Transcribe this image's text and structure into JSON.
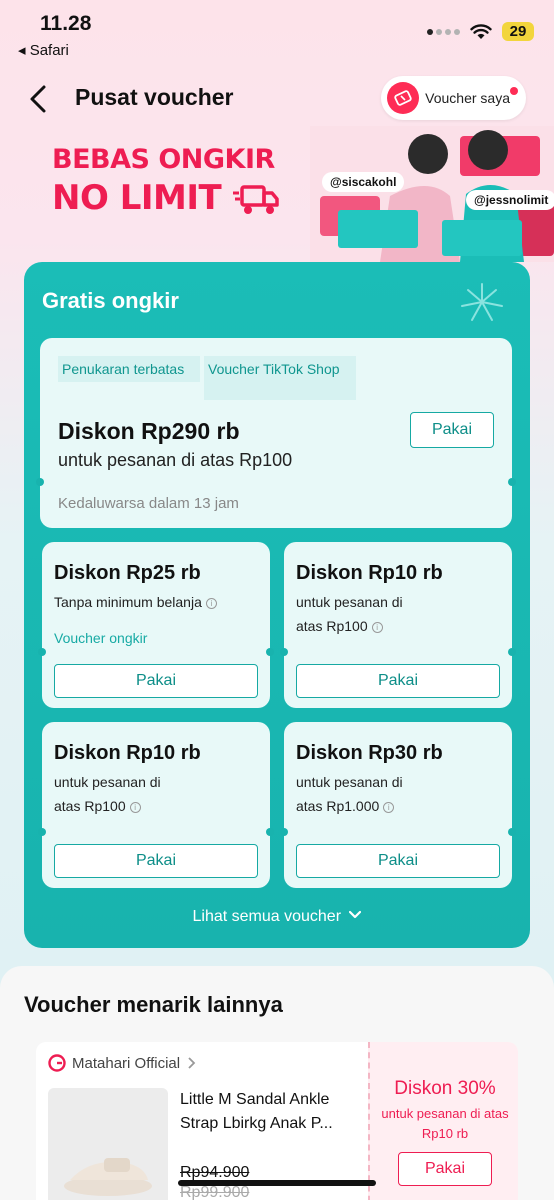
{
  "status": {
    "time": "11.28",
    "back_app": "◂ Safari",
    "battery": "29"
  },
  "header": {
    "title": "Pusat voucher",
    "my_voucher": "Voucher saya"
  },
  "banner": {
    "line1": "BEBAS ONGKIR",
    "line2": "NO LIMIT",
    "handle1": "@siscakohl",
    "handle2": "@jessnolimit"
  },
  "free_shipping": {
    "title": "Gratis ongkir",
    "featured": {
      "tag1": "Penukaran terbatas",
      "tag2": "Voucher TikTok Shop",
      "title": "Diskon Rp290 rb",
      "subtitle": "untuk pesanan di atas Rp100",
      "expiry": "Kedaluwarsa dalam 13 jam",
      "button": "Pakai"
    },
    "vouchers": [
      {
        "title": "Diskon Rp25 rb",
        "line1": "Tanpa minimum belanja",
        "line2": "",
        "link": "Voucher ongkir",
        "button": "Pakai"
      },
      {
        "title": "Diskon Rp10 rb",
        "line1": "untuk pesanan di",
        "line2": "atas Rp100",
        "link": "",
        "button": "Pakai"
      },
      {
        "title": "Diskon Rp10 rb",
        "line1": "untuk pesanan di",
        "line2": "atas Rp100",
        "link": "",
        "button": "Pakai"
      },
      {
        "title": "Diskon Rp30 rb",
        "line1": "untuk pesanan di",
        "line2": "atas Rp1.000",
        "link": "",
        "button": "Pakai"
      }
    ],
    "see_all": "Lihat semua voucher"
  },
  "other_vouchers": {
    "title": "Voucher menarik lainnya",
    "card": {
      "shop": "Matahari Official",
      "product": "Little M Sandal Ankle Strap Lbirkg Anak P...",
      "price": "Rp94.900",
      "price_original": "Rp99.900",
      "discount_title": "Diskon 30%",
      "discount_sub": "untuk pesanan di atas Rp10 rb",
      "button": "Pakai"
    }
  },
  "colors": {
    "accent_teal": "#1bbdb7",
    "brand_pink": "#ee1d52"
  }
}
